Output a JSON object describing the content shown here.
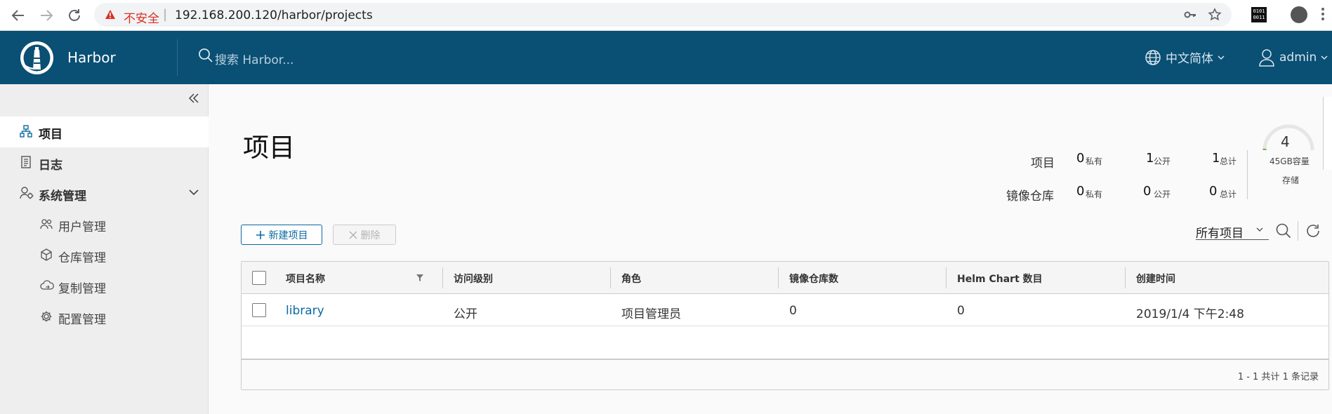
{
  "browser": {
    "insecure_label": "不安全",
    "separator": "|",
    "url": "192.168.200.120/harbor/projects",
    "ext_label": "0101\n0011"
  },
  "header": {
    "brand": "Harbor",
    "search_placeholder": "搜索 Harbor...",
    "language": "中文简体",
    "user": "admin"
  },
  "sidebar": {
    "items": [
      {
        "label": "项目",
        "icon": "projects-icon"
      },
      {
        "label": "日志",
        "icon": "logs-icon"
      },
      {
        "label": "系统管理",
        "icon": "admin-icon"
      }
    ],
    "sub_items": [
      {
        "label": "用户管理",
        "icon": "users-icon"
      },
      {
        "label": "仓库管理",
        "icon": "registry-icon"
      },
      {
        "label": "复制管理",
        "icon": "replication-icon"
      },
      {
        "label": "配置管理",
        "icon": "config-icon"
      }
    ]
  },
  "main": {
    "title": "项目",
    "stats": {
      "projects_label": "项目",
      "repos_label": "镜像仓库",
      "projects": {
        "private": "0",
        "public": "1",
        "total": "1"
      },
      "repos": {
        "private": "0",
        "public": "0",
        "total": "0"
      },
      "private_label": "私有",
      "public_label": "公开",
      "total_label": "总计"
    },
    "storage": {
      "count": "4",
      "capacity": "45GB容量",
      "label": "存储",
      "used_fraction": 0.02
    },
    "buttons": {
      "new_project": "新建项目",
      "delete": "删除"
    },
    "filter": {
      "selected": "所有项目"
    },
    "table": {
      "columns": [
        "项目名称",
        "访问级别",
        "角色",
        "镜像仓库数",
        "Helm Chart 数目",
        "创建时间"
      ],
      "rows": [
        [
          "library",
          "公开",
          "项目管理员",
          "0",
          "0",
          "2019/1/4 下午2:48"
        ]
      ],
      "footer": "1 - 1 共计 1 条记录"
    }
  },
  "colors": {
    "header_bg": "#0a4f74",
    "accent": "#0a6aa1",
    "gauge_fill": "#6bbf4a"
  }
}
